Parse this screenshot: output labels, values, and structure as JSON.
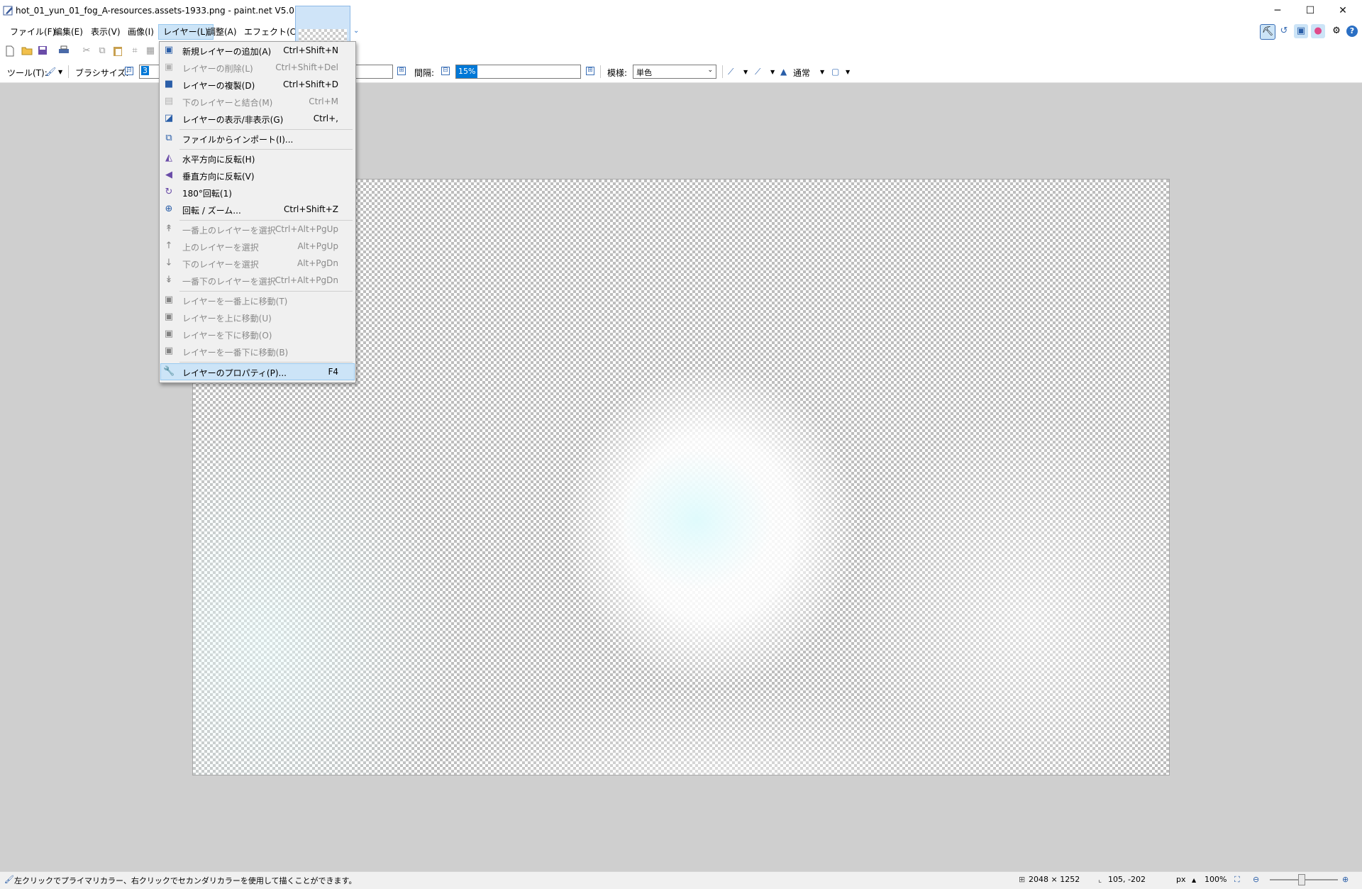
{
  "window": {
    "title": "hot_01_yun_01_fog_A-resources.assets-1933.png - paint.net V5.0.2",
    "minimize_glyph": "─",
    "maximize_glyph": "☐",
    "close_glyph": "✕"
  },
  "menubar": {
    "items": [
      {
        "label": "ファイル(F)"
      },
      {
        "label": "編集(E)"
      },
      {
        "label": "表示(V)"
      },
      {
        "label": "画像(I)"
      },
      {
        "label": "レイヤー(L)"
      },
      {
        "label": "調整(A)"
      },
      {
        "label": "エフェクト(C)"
      }
    ],
    "thumbnail_dropdown_glyph": "⌄"
  },
  "right_icons": {
    "tools_glyph": "⛏",
    "history_glyph": "↺",
    "layers_glyph": "▣",
    "colors_glyph": "●",
    "settings_glyph": "⚙",
    "help_glyph": "?"
  },
  "toolbar": {
    "tool_label": "ツール(T):",
    "brush_size_label": "ブラシサイズ:",
    "brush_size_value": "3",
    "spacing_label": "間隔:",
    "spacing_value": "15%",
    "pattern_label": "模様:",
    "pattern_value": "単色",
    "blend_mode": "通常",
    "minus_glyph": "⊟",
    "plus_glyph": "⊞"
  },
  "layer_menu": {
    "items": [
      {
        "label": "新規レイヤーの追加(A)",
        "shortcut": "Ctrl+Shift+N",
        "icon": "add-layer-icon",
        "enabled": true
      },
      {
        "label": "レイヤーの削除(L)",
        "shortcut": "Ctrl+Shift+Del",
        "icon": "delete-layer-icon",
        "enabled": false
      },
      {
        "label": "レイヤーの複製(D)",
        "shortcut": "Ctrl+Shift+D",
        "icon": "duplicate-layer-icon",
        "enabled": true
      },
      {
        "label": "下のレイヤーと結合(M)",
        "shortcut": "Ctrl+M",
        "icon": "merge-down-icon",
        "enabled": false
      },
      {
        "label": "レイヤーの表示/非表示(G)",
        "shortcut": "Ctrl+,",
        "icon": "toggle-visibility-icon",
        "enabled": true
      },
      {
        "label": "ファイルからインポート(I)...",
        "shortcut": "",
        "icon": "import-file-icon",
        "enabled": true
      },
      {
        "label": "水平方向に反転(H)",
        "shortcut": "",
        "icon": "flip-horizontal-icon",
        "enabled": true
      },
      {
        "label": "垂直方向に反転(V)",
        "shortcut": "",
        "icon": "flip-vertical-icon",
        "enabled": true
      },
      {
        "label": "180°回転(1)",
        "shortcut": "",
        "icon": "rotate-180-icon",
        "enabled": true
      },
      {
        "label": "回転 / ズーム...",
        "shortcut": "Ctrl+Shift+Z",
        "icon": "rotate-zoom-icon",
        "enabled": true
      },
      {
        "label": "一番上のレイヤーを選択",
        "shortcut": "Ctrl+Alt+PgUp",
        "icon": "select-top-layer-icon",
        "enabled": false
      },
      {
        "label": "上のレイヤーを選択",
        "shortcut": "Alt+PgUp",
        "icon": "select-layer-above-icon",
        "enabled": false
      },
      {
        "label": "下のレイヤーを選択",
        "shortcut": "Alt+PgDn",
        "icon": "select-layer-below-icon",
        "enabled": false
      },
      {
        "label": "一番下のレイヤーを選択",
        "shortcut": "Ctrl+Alt+PgDn",
        "icon": "select-bottom-layer-icon",
        "enabled": false
      },
      {
        "label": "レイヤーを一番上に移動(T)",
        "shortcut": "",
        "icon": "move-to-top-icon",
        "enabled": false
      },
      {
        "label": "レイヤーを上に移動(U)",
        "shortcut": "",
        "icon": "move-up-icon",
        "enabled": false
      },
      {
        "label": "レイヤーを下に移動(O)",
        "shortcut": "",
        "icon": "move-down-icon",
        "enabled": false
      },
      {
        "label": "レイヤーを一番下に移動(B)",
        "shortcut": "",
        "icon": "move-to-bottom-icon",
        "enabled": false
      },
      {
        "label": "レイヤーのプロパティ(P)...",
        "shortcut": "F4",
        "icon": "layer-properties-icon",
        "enabled": true
      }
    ]
  },
  "statusbar": {
    "hint": "左クリックでプライマリカラー、右クリックでセカンダリカラーを使用して描くことができます。",
    "image_size": "2048 × 1252",
    "cursor_position": "105, -202",
    "unit": "px",
    "zoom": "100%"
  },
  "colors": {
    "accent": "#cce4f7",
    "accent_border": "#99c9ef",
    "fog": "#ffffff",
    "fog_tint": "#e6fbfc"
  }
}
